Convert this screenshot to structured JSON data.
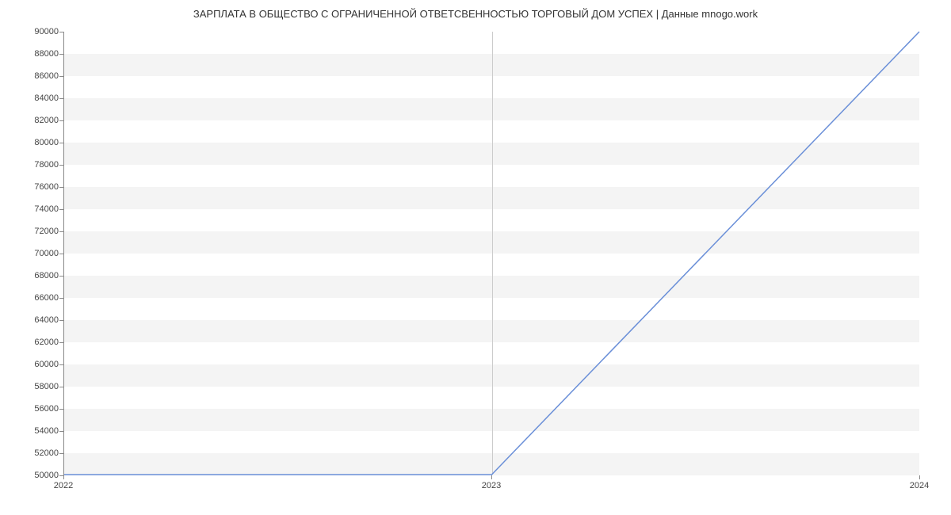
{
  "chart_data": {
    "type": "line",
    "title": "ЗАРПЛАТА В ОБЩЕСТВО С ОГРАНИЧЕННОЙ  ОТВЕТСВЕННОСТЬЮ ТОРГОВЫЙ ДОМ УСПЕХ | Данные mnogo.work",
    "x": [
      2022,
      2023,
      2024
    ],
    "values": [
      50000,
      50000,
      90000
    ],
    "xlabel": "",
    "ylabel": "",
    "ylim": [
      50000,
      90000
    ],
    "y_ticks": [
      50000,
      52000,
      54000,
      56000,
      58000,
      60000,
      62000,
      64000,
      66000,
      68000,
      70000,
      72000,
      74000,
      76000,
      78000,
      80000,
      82000,
      84000,
      86000,
      88000,
      90000
    ],
    "x_ticks": [
      2022,
      2023,
      2024
    ],
    "line_color": "#6a8fd8"
  }
}
